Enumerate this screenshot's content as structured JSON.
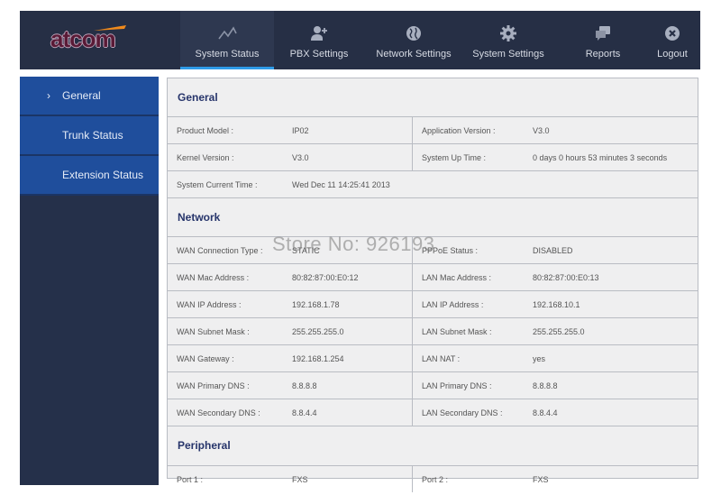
{
  "brand": {
    "logo_text": "atcom",
    "accent": "#f08a1c"
  },
  "colors": {
    "topnav_bg": "#262f45",
    "active_underline": "#2f9be8",
    "sidebar_item_bg": "#1f4e9c",
    "sidebar_bg": "#25304a",
    "panel_bg": "#efeff0",
    "section_title": "#27356b"
  },
  "nav": {
    "items": [
      {
        "label": "System Status",
        "icon": "chart-line-icon",
        "active": true
      },
      {
        "label": "PBX Settings",
        "icon": "user-add-icon",
        "active": false
      },
      {
        "label": "Network Settings",
        "icon": "globe-icon",
        "active": false
      },
      {
        "label": "System Settings",
        "icon": "gear-icon",
        "active": false
      },
      {
        "label": "Reports",
        "icon": "chat-bubbles-icon",
        "active": false
      },
      {
        "label": "Logout",
        "icon": "close-circle-icon",
        "active": false
      }
    ]
  },
  "sidebar": {
    "items": [
      {
        "label": "General",
        "active": true,
        "chevron": "›"
      },
      {
        "label": "Trunk Status",
        "active": false
      },
      {
        "label": "Extension Status",
        "active": false
      }
    ]
  },
  "sections": {
    "general": {
      "title": "General",
      "rows": [
        {
          "label1": "Product Model :",
          "value1": "IP02",
          "label2": "Application Version :",
          "value2": "V3.0"
        },
        {
          "label1": "Kernel Version :",
          "value1": "V3.0",
          "label2": "System Up Time :",
          "value2": "0 days 0 hours 53 minutes 3 seconds"
        },
        {
          "label1": "System Current Time :",
          "value1": "Wed Dec 11 14:25:41 2013"
        }
      ]
    },
    "network": {
      "title": "Network",
      "rows": [
        {
          "label1": "WAN Connection Type :",
          "value1": "STATIC",
          "label2": "PPPoE Status :",
          "value2": "DISABLED"
        },
        {
          "label1": "WAN Mac Address :",
          "value1": "80:82:87:00:E0:12",
          "label2": "LAN Mac Address :",
          "value2": "80:82:87:00:E0:13"
        },
        {
          "label1": "WAN IP Address :",
          "value1": "192.168.1.78",
          "label2": "LAN IP Address :",
          "value2": "192.168.10.1"
        },
        {
          "label1": "WAN Subnet Mask :",
          "value1": "255.255.255.0",
          "label2": "LAN Subnet Mask :",
          "value2": "255.255.255.0"
        },
        {
          "label1": "WAN Gateway :",
          "value1": "192.168.1.254",
          "label2": "LAN NAT :",
          "value2": "yes"
        },
        {
          "label1": "WAN Primary DNS :",
          "value1": "8.8.8.8",
          "label2": "LAN Primary DNS :",
          "value2": "8.8.8.8"
        },
        {
          "label1": "WAN Secondary DNS :",
          "value1": "8.8.4.4",
          "label2": "LAN Secondary DNS :",
          "value2": "8.8.4.4"
        }
      ]
    },
    "peripheral": {
      "title": "Peripheral",
      "rows": [
        {
          "label1": "Port 1 :",
          "value1": "FXS",
          "label2": "Port 2 :",
          "value2": "FXS"
        }
      ]
    }
  },
  "watermark": "Store No: 926193"
}
